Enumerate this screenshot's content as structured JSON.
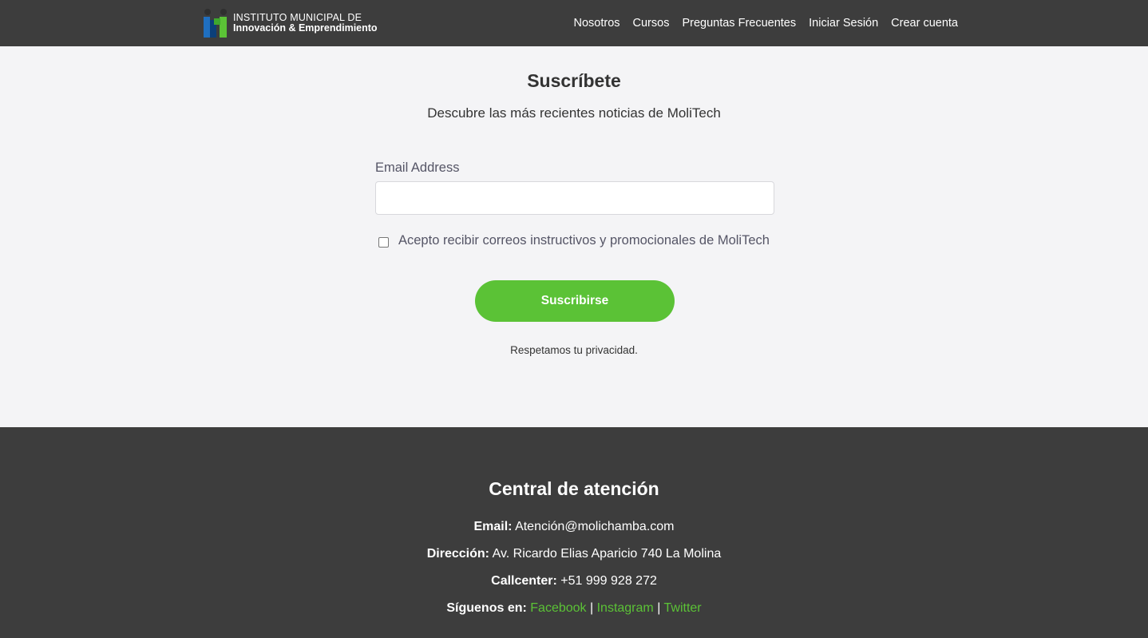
{
  "header": {
    "logo": {
      "line1": "INSTITUTO MUNICIPAL DE",
      "line2": "Innovación & Emprendimiento"
    },
    "nav": [
      "Nosotros",
      "Cursos",
      "Preguntas Frecuentes",
      "Iniciar Sesión",
      "Crear cuenta"
    ]
  },
  "subscribe": {
    "title": "Suscríbete",
    "description": "Descubre las más recientes noticias de MoliTech",
    "email_label": "Email Address",
    "email_value": "",
    "email_placeholder": "",
    "consent_text": "Acepto recibir correos instructivos y promocionales de MoliTech",
    "consent_checked": false,
    "button_label": "Suscribirse",
    "privacy_note": "Respetamos tu privacidad."
  },
  "footer": {
    "title": "Central de atención",
    "email_label": "Email:",
    "email_value": "Atención@molichamba.com",
    "address_label": "Dirección:",
    "address_value": "Av. Ricardo Elias Aparicio 740 La Molina",
    "callcenter_label": "Callcenter:",
    "callcenter_value": "+51 999 928 272",
    "social_label": "Síguenos en:",
    "social_links": [
      "Facebook",
      "Instagram",
      "Twitter"
    ],
    "separator": "|"
  },
  "colors": {
    "header_bg": "#3d3d3d",
    "page_bg": "#f4f4f6",
    "accent_green": "#5bc236"
  },
  "icons": {
    "logo": "institute-logo-icon"
  }
}
